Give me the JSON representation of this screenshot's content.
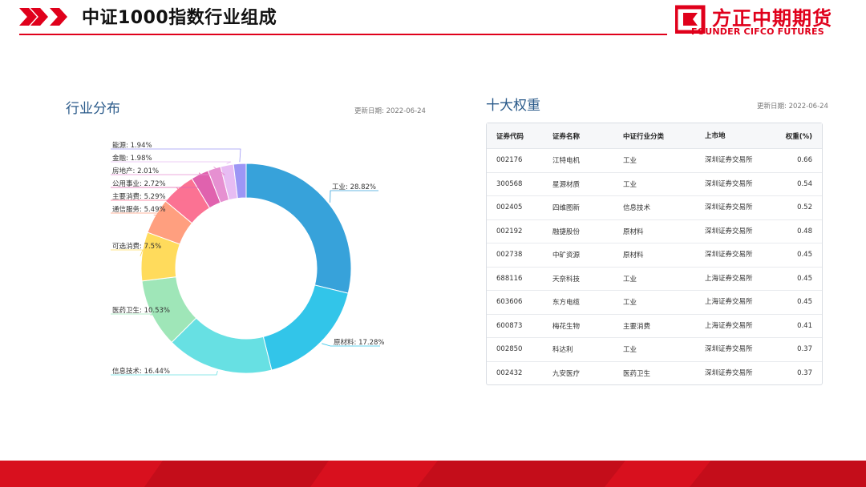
{
  "header": {
    "title": "中证1000指数行业组成",
    "logo_cn": "方正中期期货",
    "logo_en": "FOUNDER CIFCO FUTURES"
  },
  "left_panel": {
    "title": "行业分布",
    "update_label": "更新日期: 2022-06-24"
  },
  "right_panel": {
    "title": "十大权重",
    "update_label": "更新日期: 2022-06-24",
    "columns": [
      "证券代码",
      "证券名称",
      "中证行业分类",
      "上市地",
      "权重(%)"
    ],
    "rows": [
      [
        "002176",
        "江特电机",
        "工业",
        "深圳证券交易所",
        "0.66"
      ],
      [
        "300568",
        "星源材质",
        "工业",
        "深圳证券交易所",
        "0.54"
      ],
      [
        "002405",
        "四维图新",
        "信息技术",
        "深圳证券交易所",
        "0.52"
      ],
      [
        "002192",
        "融捷股份",
        "原材料",
        "深圳证券交易所",
        "0.48"
      ],
      [
        "002738",
        "中矿资源",
        "原材料",
        "深圳证券交易所",
        "0.45"
      ],
      [
        "688116",
        "天奈科技",
        "工业",
        "上海证券交易所",
        "0.45"
      ],
      [
        "603606",
        "东方电缆",
        "工业",
        "上海证券交易所",
        "0.45"
      ],
      [
        "600873",
        "梅花生物",
        "主要消费",
        "上海证券交易所",
        "0.41"
      ],
      [
        "002850",
        "科达利",
        "工业",
        "深圳证券交易所",
        "0.37"
      ],
      [
        "002432",
        "九安医疗",
        "医药卫生",
        "深圳证券交易所",
        "0.37"
      ]
    ]
  },
  "colors": {
    "brand_red": "#e0001b",
    "section_title": "#2a5a8a"
  },
  "chart_data": {
    "type": "pie",
    "donut": true,
    "slices": [
      {
        "label": "工业",
        "value": 28.82,
        "color": "#37a2da"
      },
      {
        "label": "原材料",
        "value": 17.28,
        "color": "#32c5e9"
      },
      {
        "label": "信息技术",
        "value": 16.44,
        "color": "#67e0e3"
      },
      {
        "label": "医药卫生",
        "value": 10.53,
        "color": "#9fe6b8"
      },
      {
        "label": "可选消费",
        "value": 7.5,
        "color": "#ffdb5c"
      },
      {
        "label": "通信服务",
        "value": 5.49,
        "color": "#ff9f7f"
      },
      {
        "label": "主要消费",
        "value": 5.29,
        "color": "#fb7293"
      },
      {
        "label": "公用事业",
        "value": 2.72,
        "color": "#e062ae"
      },
      {
        "label": "房地产",
        "value": 2.01,
        "color": "#e690d1"
      },
      {
        "label": "金融",
        "value": 1.98,
        "color": "#e7bcf3"
      },
      {
        "label": "能源",
        "value": 1.94,
        "color": "#9d96f5"
      }
    ],
    "value_suffix": "%"
  }
}
